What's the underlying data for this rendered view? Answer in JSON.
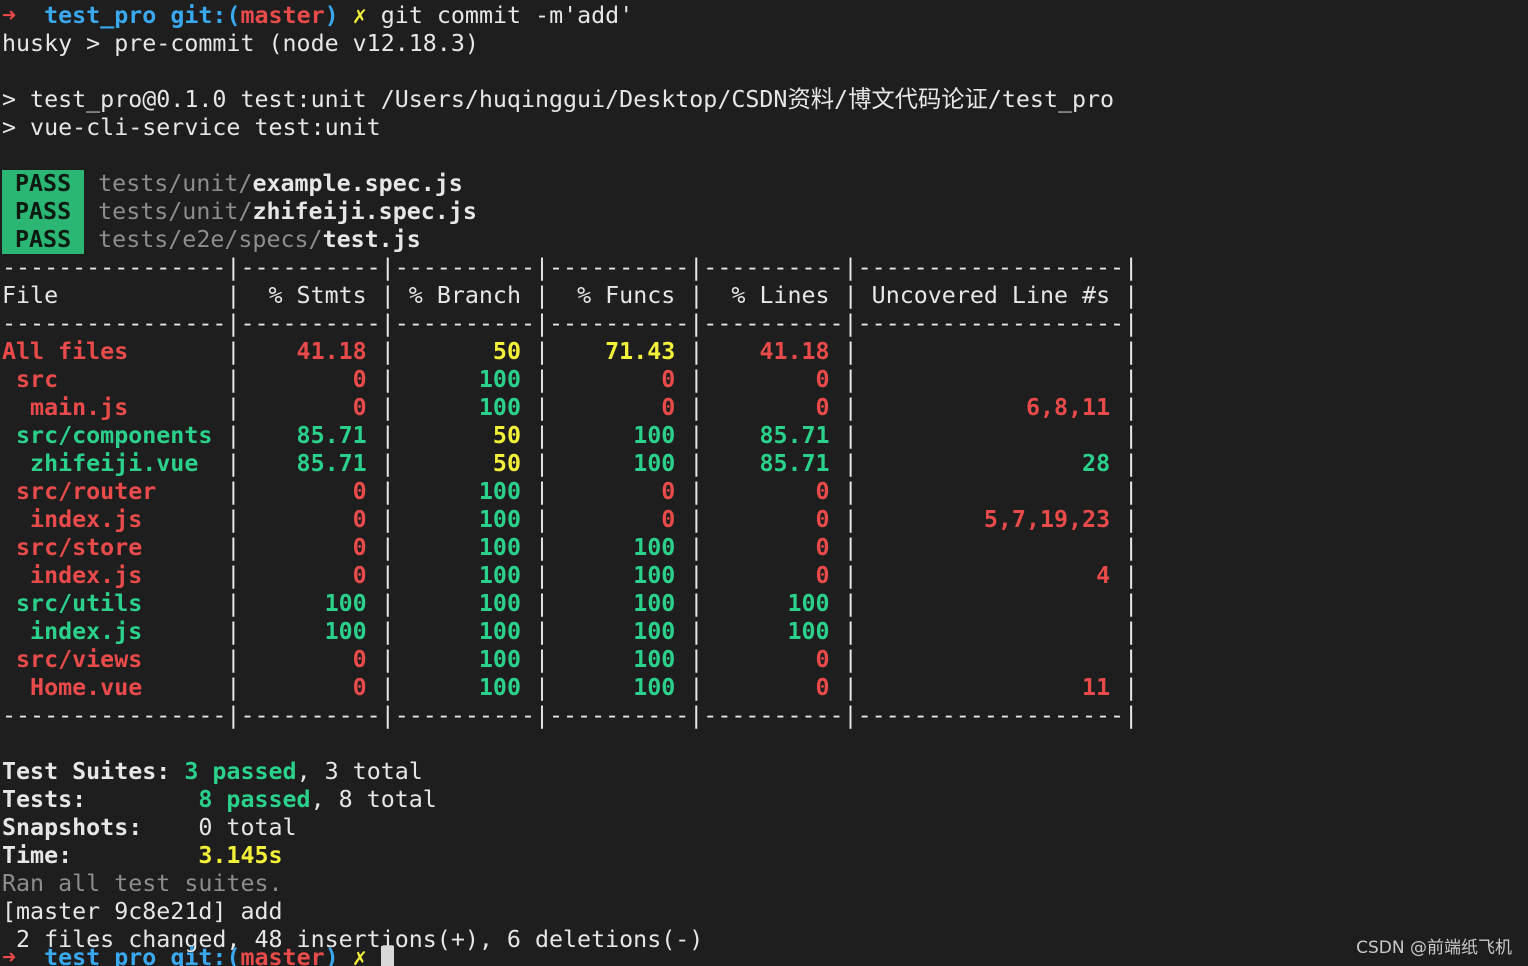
{
  "prompt": {
    "arrow": "➜",
    "dir": "test_pro",
    "git_label": "git:(",
    "branch": "master",
    "git_close": ")",
    "dirty": "✗",
    "command": "git commit -m'add'"
  },
  "husky_line": "husky > pre-commit (node v12.18.3)",
  "npm_lines": [
    "> test_pro@0.1.0 test:unit /Users/huqinggui/Desktop/CSDN资料/博文代码论证/test_pro",
    "> vue-cli-service test:unit"
  ],
  "pass_badge": "PASS",
  "tests": [
    {
      "dir": "tests/unit/",
      "file": "example.spec.js"
    },
    {
      "dir": "tests/unit/",
      "file": "zhifeiji.spec.js"
    },
    {
      "dir": "tests/e2e/specs/",
      "file": "test.js"
    }
  ],
  "coverage": {
    "separator": "----------------|----------|----------|----------|----------|-------------------|",
    "headers": [
      "File",
      "% Stmts",
      "% Branch",
      "% Funcs",
      "% Lines",
      "Uncovered Line #s"
    ],
    "rows": [
      {
        "file": "All files",
        "stmts": "41.18",
        "branch": "50",
        "funcs": "71.43",
        "lines": "41.18",
        "uncovered": ""
      },
      {
        "file": " src",
        "stmts": "0",
        "branch": "100",
        "funcs": "0",
        "lines": "0",
        "uncovered": ""
      },
      {
        "file": "  main.js",
        "stmts": "0",
        "branch": "100",
        "funcs": "0",
        "lines": "0",
        "uncovered": "6,8,11"
      },
      {
        "file": " src/components",
        "stmts": "85.71",
        "branch": "50",
        "funcs": "100",
        "lines": "85.71",
        "uncovered": ""
      },
      {
        "file": "  zhifeiji.vue",
        "stmts": "85.71",
        "branch": "50",
        "funcs": "100",
        "lines": "85.71",
        "uncovered": "28"
      },
      {
        "file": " src/router",
        "stmts": "0",
        "branch": "100",
        "funcs": "0",
        "lines": "0",
        "uncovered": ""
      },
      {
        "file": "  index.js",
        "stmts": "0",
        "branch": "100",
        "funcs": "0",
        "lines": "0",
        "uncovered": "5,7,19,23"
      },
      {
        "file": " src/store",
        "stmts": "0",
        "branch": "100",
        "funcs": "100",
        "lines": "0",
        "uncovered": ""
      },
      {
        "file": "  index.js",
        "stmts": "0",
        "branch": "100",
        "funcs": "100",
        "lines": "0",
        "uncovered": "4"
      },
      {
        "file": " src/utils",
        "stmts": "100",
        "branch": "100",
        "funcs": "100",
        "lines": "100",
        "uncovered": ""
      },
      {
        "file": "  index.js",
        "stmts": "100",
        "branch": "100",
        "funcs": "100",
        "lines": "100",
        "uncovered": ""
      },
      {
        "file": " src/views",
        "stmts": "0",
        "branch": "100",
        "funcs": "100",
        "lines": "0",
        "uncovered": ""
      },
      {
        "file": "  Home.vue",
        "stmts": "0",
        "branch": "100",
        "funcs": "100",
        "lines": "0",
        "uncovered": "11"
      }
    ]
  },
  "summary": {
    "suites_label": "Test Suites:",
    "suites_passed": "3 passed",
    "suites_total": "3 total",
    "tests_label": "Tests:",
    "tests_passed": "8 passed",
    "tests_total": "8 total",
    "snapshots_label": "Snapshots:",
    "snapshots_total": "0 total",
    "time_label": "Time:",
    "time_value": "3.145s",
    "ran_all": "Ran all test suites."
  },
  "commit_line": "[master 9c8e21d] add",
  "changes_line": " 2 files changed, 48 insertions(+), 6 deletions(-)",
  "watermark": "CSDN @前端纸飞机",
  "colors": {
    "background": "#1e1e1e",
    "red": "#e94a4a",
    "green": "#2bd18b",
    "yellow": "#f3f03a",
    "blue": "#3aa8ef",
    "pass_badge": "#2bb673"
  }
}
